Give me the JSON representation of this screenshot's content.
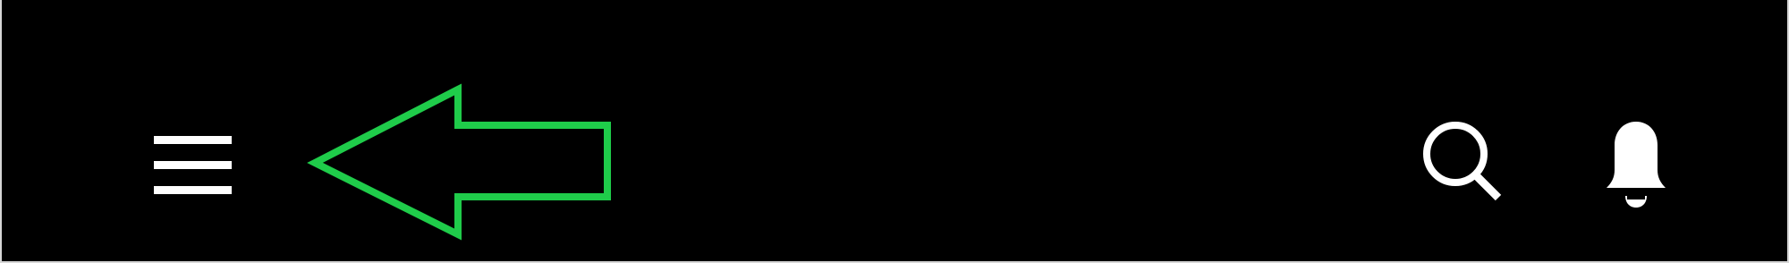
{
  "app_bar": {
    "background": "#000000",
    "icon_color": "#ffffff",
    "menu_icon": "hamburger-menu-icon",
    "search_icon": "search-icon",
    "notifications_icon": "bell-icon"
  },
  "annotation": {
    "shape": "left-arrow-outline",
    "color": "#1fcc4a",
    "points_to": "hamburger-menu-icon"
  }
}
